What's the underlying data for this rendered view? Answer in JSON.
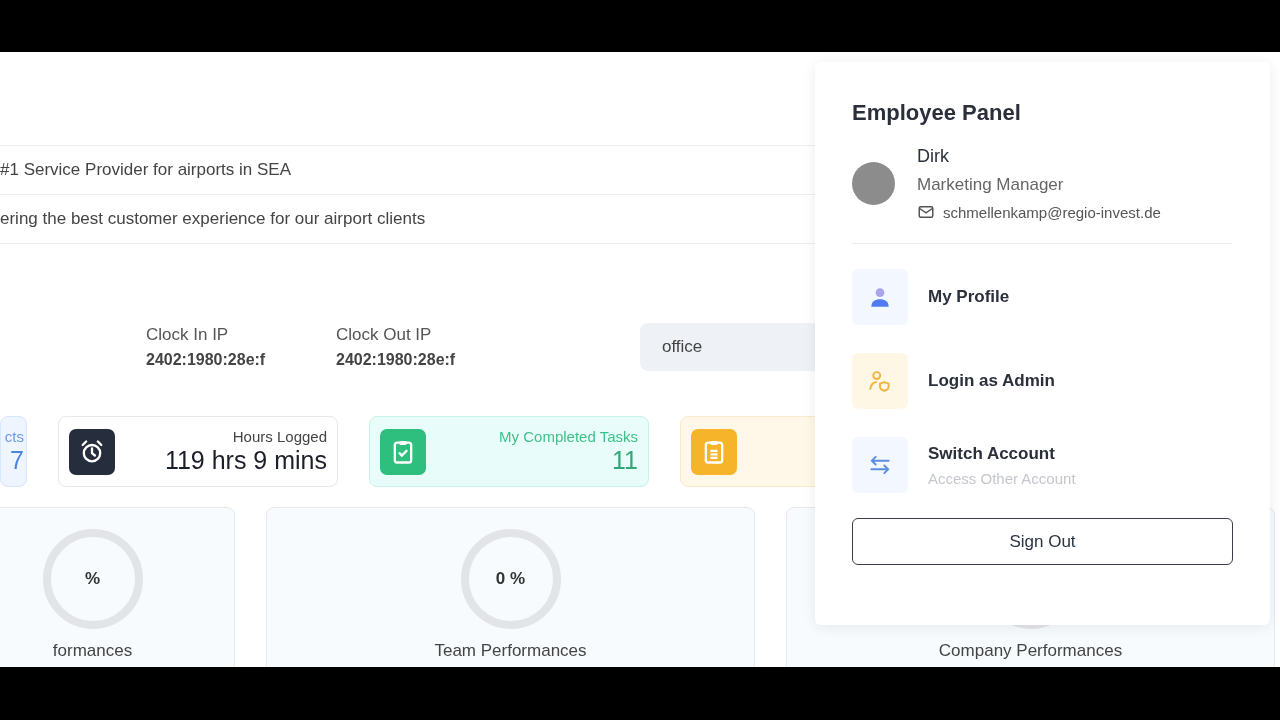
{
  "header_rows": [
    "#1 Service Provider for airports in SEA",
    "ering the best customer experience for our airport clients"
  ],
  "clock": [
    {
      "label": "Clock In IP",
      "value": "2402:1980:28e:f"
    },
    {
      "label": "Clock Out IP",
      "value": "2402:1980:28e:f"
    }
  ],
  "location_field": {
    "value": "office"
  },
  "stat_cards": [
    {
      "kind": "blue",
      "label": "cts",
      "value": "7"
    },
    {
      "kind": "dark",
      "label": "Hours Logged",
      "value": "119 hrs 9 mins"
    },
    {
      "kind": "green",
      "label": "My Completed Tasks",
      "value": "11"
    },
    {
      "kind": "amber"
    }
  ],
  "performance_cards": [
    {
      "reading": "%",
      "label": "formances"
    },
    {
      "reading": "0 %",
      "label": "Team Performances"
    },
    {
      "label": "Company Performances"
    }
  ],
  "employee_panel": {
    "title": "Employee Panel",
    "name": "Dirk",
    "role": "Marketing Manager",
    "email": "schmellenkamp@regio-invest.de",
    "menu": [
      {
        "kind": "profile",
        "label": "My Profile"
      },
      {
        "kind": "admin",
        "label": "Login as Admin"
      },
      {
        "kind": "switch",
        "label": "Switch Account",
        "subtitle": "Access Other Account"
      }
    ],
    "sign_out": "Sign Out"
  }
}
